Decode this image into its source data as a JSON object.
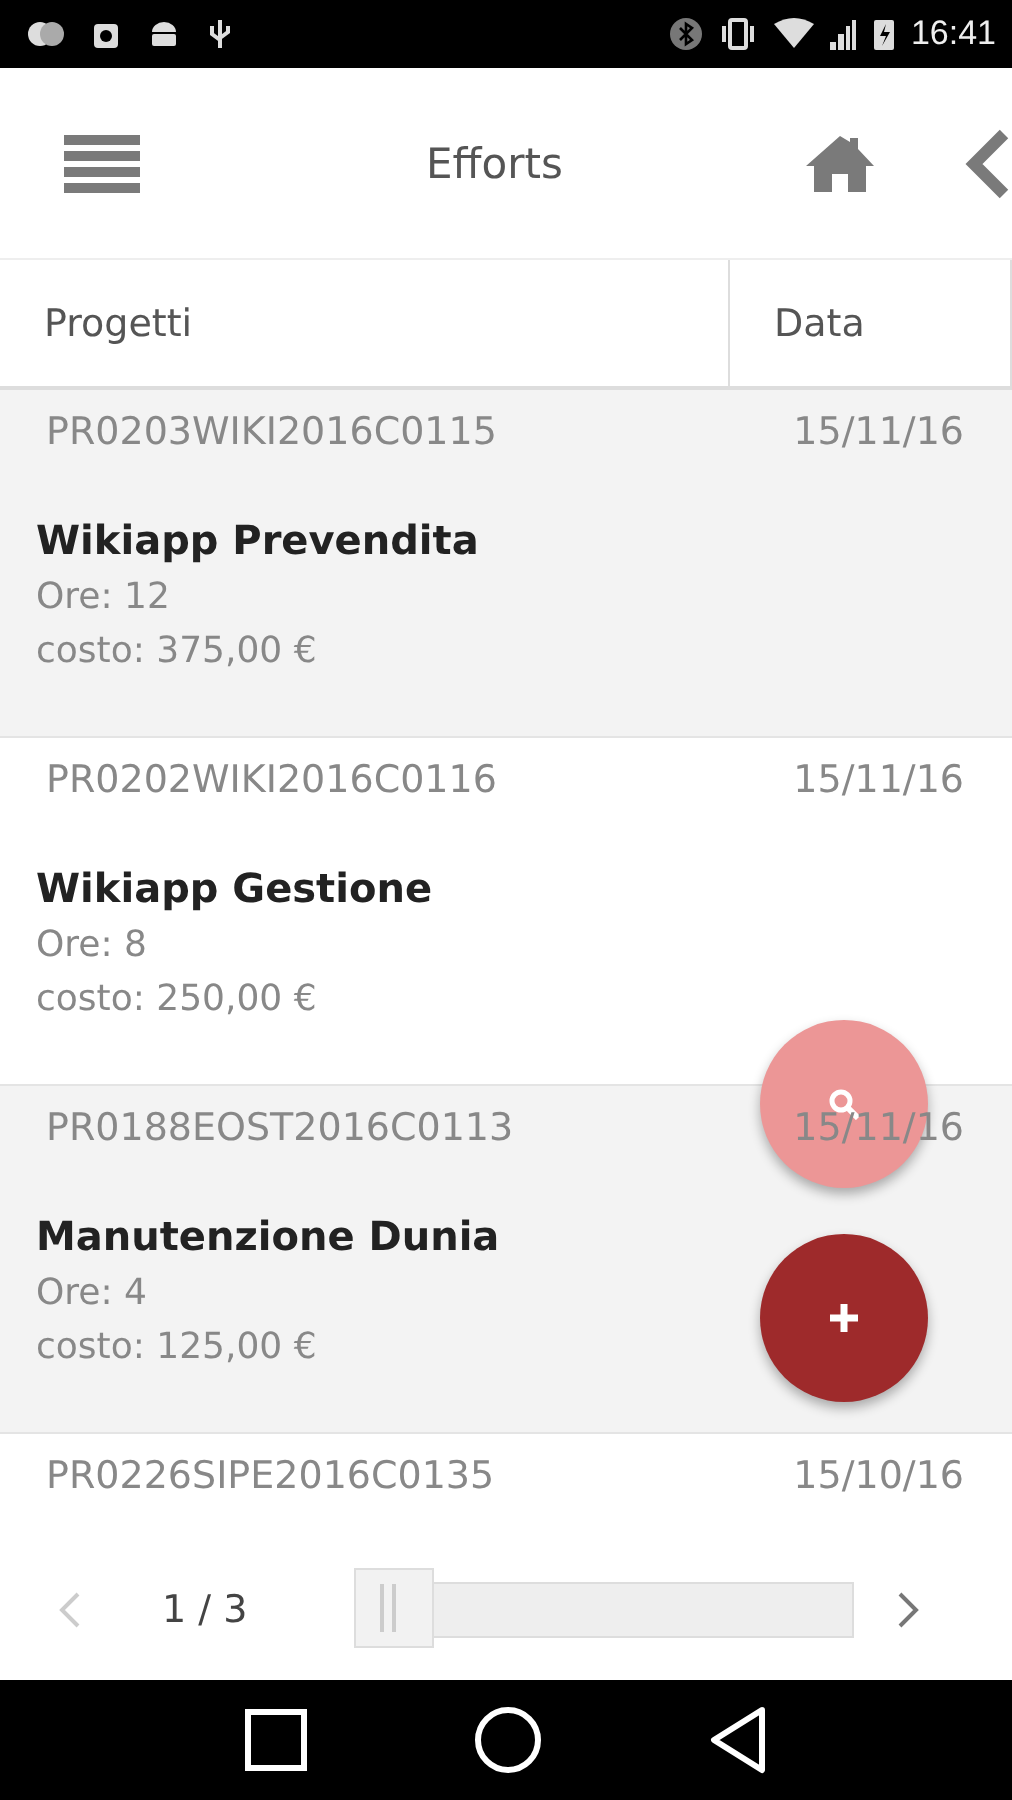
{
  "status_bar": {
    "time": "16:41"
  },
  "header": {
    "title": "Efforts"
  },
  "table": {
    "columns": [
      "Progetti",
      "Data"
    ],
    "rows": [
      {
        "code": "PR0203WIKI2016C0115",
        "date": "15/11/16",
        "title": "Wikiapp Prevendita",
        "hours": "Ore: 12",
        "cost": "costo: 375,00 €"
      },
      {
        "code": "PR0202WIKI2016C0116",
        "date": "15/11/16",
        "title": "Wikiapp Gestione",
        "hours": "Ore: 8",
        "cost": "costo: 250,00 €"
      },
      {
        "code": "PR0188EOST2016C0113",
        "date": "15/11/16",
        "title": "Manutenzione Dunia",
        "hours": "Ore: 4",
        "cost": "costo: 125,00 €"
      },
      {
        "code": "PR0226SIPE2016C0135",
        "date": "15/10/16"
      }
    ]
  },
  "pager": {
    "page": "1 / 3",
    "level": 0
  }
}
